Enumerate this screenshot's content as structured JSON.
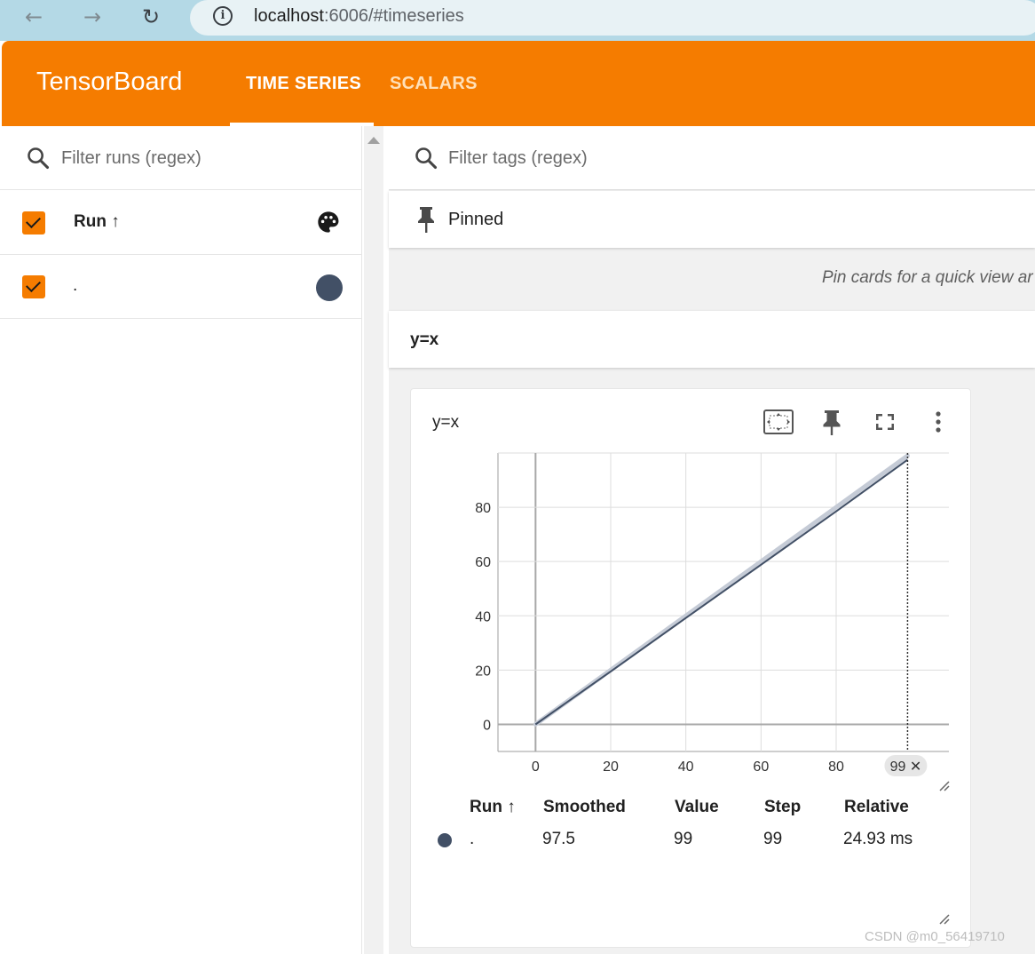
{
  "browser": {
    "url_host": "localhost",
    "url_rest": ":6006/#timeseries",
    "back_icon": "arrow-left-icon",
    "forward_icon": "arrow-right-icon",
    "reload_icon": "reload-icon",
    "info_icon": "info-icon"
  },
  "header": {
    "title": "TensorBoard",
    "tabs": [
      {
        "label": "TIME SERIES",
        "active": true
      },
      {
        "label": "SCALARS",
        "active": false
      }
    ],
    "color": "#f57c00"
  },
  "sidebar": {
    "filter_placeholder": "Filter runs (regex)",
    "column_label": "Run ↑",
    "runs": [
      {
        "name": ".",
        "checked": true,
        "color": "#425066"
      }
    ]
  },
  "main": {
    "tags_filter_placeholder": "Filter tags (regex)",
    "pinned_label": "Pinned",
    "pin_hint": "Pin cards for a quick view ar",
    "group_title": "y=x",
    "card": {
      "title": "y=x",
      "icons": [
        "fit-domain-icon",
        "pin-icon",
        "fullscreen-icon",
        "more-vert-icon"
      ]
    },
    "tooltip": {
      "headers": [
        "Run ↑",
        "Smoothed",
        "Value",
        "Step",
        "Relative"
      ],
      "row": {
        "run": ".",
        "smoothed": "97.5",
        "value": "99",
        "step": "99",
        "relative": "24.93 ms"
      }
    }
  },
  "chart_data": {
    "type": "line",
    "title": "y=x",
    "x_ticks": [
      "0",
      "20",
      "40",
      "60",
      "80"
    ],
    "y_ticks": [
      "0",
      "20",
      "40",
      "60",
      "80"
    ],
    "xlim": [
      -10,
      110
    ],
    "ylim": [
      -10,
      100
    ],
    "series": [
      {
        "name": ".",
        "color": "#425066",
        "x": [
          0,
          20,
          40,
          60,
          80,
          99
        ],
        "values": [
          0,
          19.5,
          39.2,
          58.8,
          78.5,
          97.5
        ]
      }
    ],
    "raw_color": "#c5cbd6",
    "hover_step": "99",
    "hover_step_label": "99 ✕"
  },
  "watermark": "CSDN @m0_56419710"
}
